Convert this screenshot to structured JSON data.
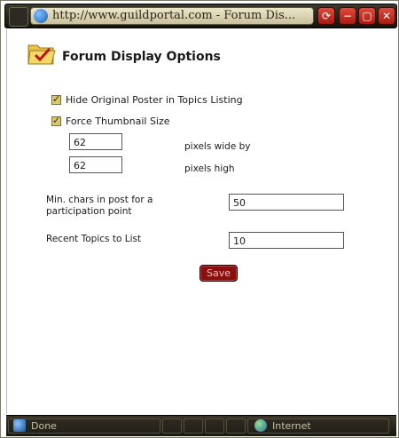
{
  "window": {
    "url_title": "http://www.guildportal.com - Forum Dis...",
    "buttons": {
      "options": "⟳",
      "minimize": "−",
      "maximize": "▢",
      "close": "✕"
    }
  },
  "page": {
    "title": "Forum Display Options"
  },
  "options": {
    "hide_op_label": "Hide Original Poster in Topics Listing",
    "hide_op_checked": true,
    "force_thumb_label": "Force Thumbnail Size",
    "force_thumb_checked": true,
    "thumb_width_value": "62",
    "thumb_width_label": "pixels wide by",
    "thumb_height_value": "62",
    "thumb_height_label": "pixels high",
    "min_chars_label_line1": "Min. chars in post for a",
    "min_chars_label_line2": "participation point",
    "min_chars_value": "50",
    "recent_topics_label": "Recent Topics to List",
    "recent_topics_value": "10",
    "save_label": "Save"
  },
  "statusbar": {
    "status": "Done",
    "zone": "Internet"
  },
  "colors": {
    "titlebar": "#1e1b12",
    "save_button": "#8a1010",
    "checkbox": "#d8c870"
  }
}
